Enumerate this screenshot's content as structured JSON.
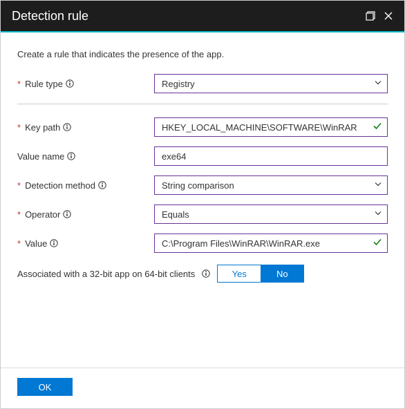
{
  "header": {
    "title": "Detection rule"
  },
  "description": "Create a rule that indicates the presence of the app.",
  "fields": {
    "ruleType": {
      "label": "Rule type",
      "value": "Registry",
      "required": true
    },
    "keyPath": {
      "label": "Key path",
      "value": "HKEY_LOCAL_MACHINE\\SOFTWARE\\WinRAR",
      "required": true,
      "valid": true
    },
    "valueName": {
      "label": "Value name",
      "value": "exe64",
      "required": false
    },
    "detectionMethod": {
      "label": "Detection method",
      "value": "String comparison",
      "required": true
    },
    "operator": {
      "label": "Operator",
      "value": "Equals",
      "required": true
    },
    "value": {
      "label": "Value",
      "value": "C:\\Program Files\\WinRAR\\WinRAR.exe",
      "required": true,
      "valid": true
    }
  },
  "assoc32": {
    "label": "Associated with a 32-bit app on 64-bit clients",
    "yes": "Yes",
    "no": "No",
    "selected": "No"
  },
  "footer": {
    "ok": "OK"
  }
}
